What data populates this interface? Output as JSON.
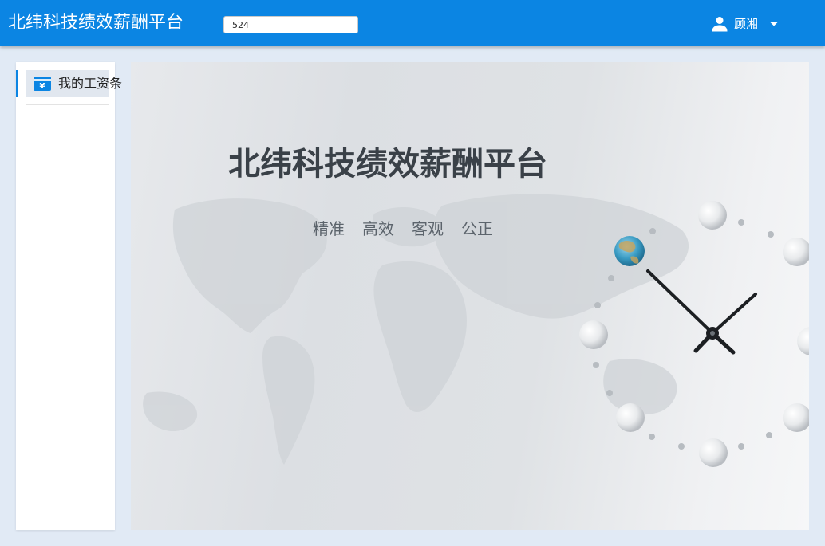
{
  "header": {
    "app_title": "北纬科技绩效薪酬平台",
    "input_value": "524",
    "user_name": "顾湘",
    "icons": {
      "user": "user-icon",
      "dropdown": "caret-down-icon"
    }
  },
  "sidebar": {
    "items": [
      {
        "label": "我的工资条",
        "icon": "salary-card-icon",
        "active": true
      }
    ]
  },
  "banner": {
    "title": "北纬科技绩效薪酬平台",
    "slogans": [
      "精准",
      "高效",
      "客观",
      "公正"
    ]
  },
  "colors": {
    "primary": "#0b85e3",
    "background": "#e1eaf5",
    "title_text": "#3a4148"
  }
}
